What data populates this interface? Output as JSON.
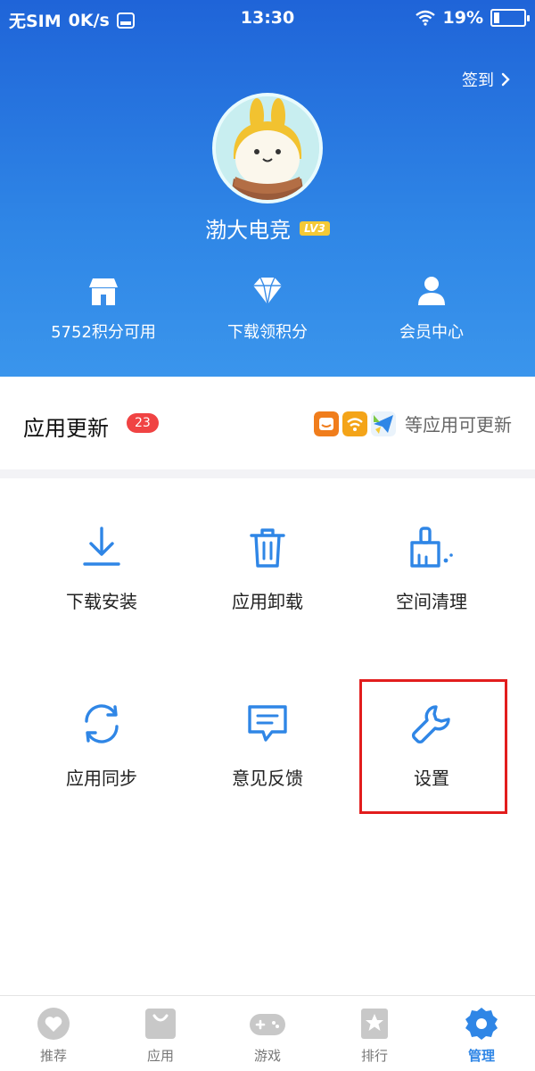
{
  "status_bar": {
    "carrier": "无SIM",
    "speed": "0K/s",
    "time": "13:30",
    "battery": "19%",
    "battery_level": 0.19
  },
  "header": {
    "signin_label": "签到",
    "username": "渤大电竞",
    "level_badge": "LV3",
    "stats": [
      {
        "label": "5752积分可用",
        "icon": "store-icon"
      },
      {
        "label": "下载领积分",
        "icon": "diamond-icon"
      },
      {
        "label": "会员中心",
        "icon": "person-icon"
      }
    ]
  },
  "updates": {
    "title": "应用更新",
    "count": "23",
    "suffix": "等应用可更新"
  },
  "grid": [
    {
      "label": "下载安装",
      "icon": "download-icon"
    },
    {
      "label": "应用卸载",
      "icon": "trash-icon"
    },
    {
      "label": "空间清理",
      "icon": "broom-icon"
    },
    {
      "label": "应用同步",
      "icon": "sync-icon"
    },
    {
      "label": "意见反馈",
      "icon": "feedback-icon"
    },
    {
      "label": "设置",
      "icon": "wrench-icon"
    }
  ],
  "bottom_nav": [
    {
      "label": "推荐",
      "icon": "heart-icon",
      "active": false
    },
    {
      "label": "应用",
      "icon": "bag-icon",
      "active": false
    },
    {
      "label": "游戏",
      "icon": "gamepad-icon",
      "active": false
    },
    {
      "label": "排行",
      "icon": "star-icon",
      "active": false
    },
    {
      "label": "管理",
      "icon": "gear-icon",
      "active": true
    }
  ],
  "colors": {
    "accent": "#2f86e6",
    "header_top": "#1f64d8",
    "badge_red": "#f04343",
    "highlight_red": "#e21d1d",
    "level_gold": "#f4c936"
  }
}
